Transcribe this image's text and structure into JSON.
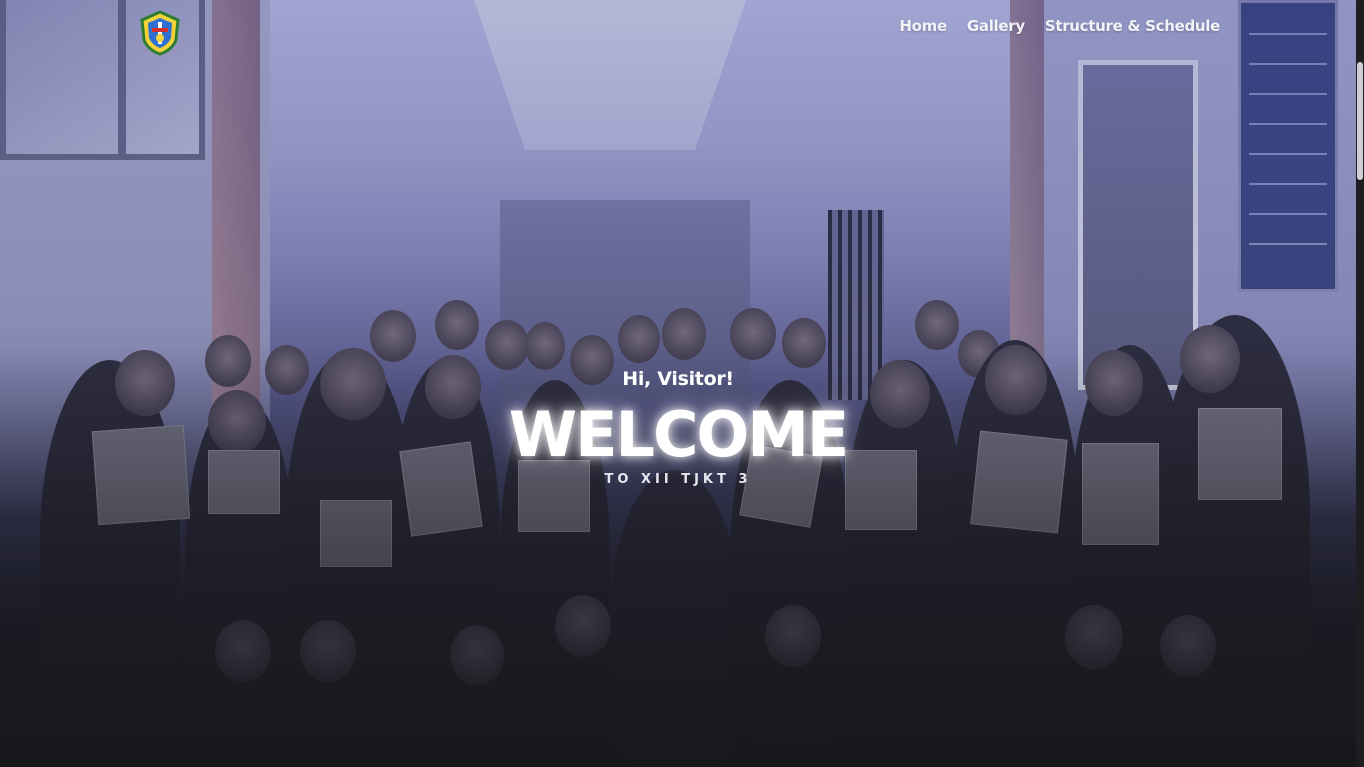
{
  "nav": {
    "logo_icon": "school-crest-logo",
    "items": [
      {
        "label": "Home"
      },
      {
        "label": "Gallery"
      },
      {
        "label": "Structure & Schedule"
      }
    ]
  },
  "hero": {
    "greeting": "Hi, Visitor!",
    "headline": "WELCOME",
    "subtitle": "TO XII TJKT 3",
    "background": "class-group-photo"
  },
  "colors": {
    "overlay_tint": "#3a3f9a",
    "text": "#ffffff",
    "page_bottom": "#1c1c20"
  }
}
